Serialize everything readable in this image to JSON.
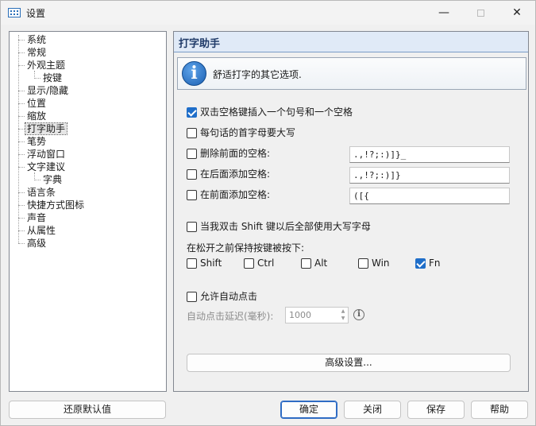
{
  "window": {
    "title": "设置"
  },
  "tree": {
    "items": [
      {
        "label": "系统",
        "level": 0
      },
      {
        "label": "常规",
        "level": 0
      },
      {
        "label": "外观主题",
        "level": 0
      },
      {
        "label": "按键",
        "level": 1
      },
      {
        "label": "显示/隐藏",
        "level": 0
      },
      {
        "label": "位置",
        "level": 0
      },
      {
        "label": "缩放",
        "level": 0
      },
      {
        "label": "打字助手",
        "level": 0,
        "selected": true
      },
      {
        "label": "笔势",
        "level": 0
      },
      {
        "label": "浮动窗口",
        "level": 0
      },
      {
        "label": "文字建议",
        "level": 0
      },
      {
        "label": "字典",
        "level": 1
      },
      {
        "label": "语言条",
        "level": 0
      },
      {
        "label": "快捷方式图标",
        "level": 0
      },
      {
        "label": "声音",
        "level": 0
      },
      {
        "label": "从属性",
        "level": 0
      },
      {
        "label": "高级",
        "level": 0
      }
    ]
  },
  "panel": {
    "title": "打字助手",
    "info": "舒适打字的其它选项.",
    "options": {
      "double_space": {
        "label": "双击空格键插入一个句号和一个空格",
        "checked": true
      },
      "capitalize": {
        "label": "每句话的首字母要大写",
        "checked": false
      },
      "delete_before": {
        "label": "删除前面的空格:",
        "checked": false,
        "value": ".,!?;:)]}_"
      },
      "add_after": {
        "label": "在后面添加空格:",
        "checked": false,
        "value": ".,!?;:)]}"
      },
      "add_before": {
        "label": "在前面添加空格:",
        "checked": false,
        "value": "([{"
      },
      "shift_caps": {
        "label": "当我双击 Shift 键以后全部使用大写字母",
        "checked": false
      }
    },
    "hold_label": "在松开之前保持按键被按下:",
    "hold_keys": [
      {
        "label": "Shift",
        "checked": false
      },
      {
        "label": "Ctrl",
        "checked": false
      },
      {
        "label": "Alt",
        "checked": false
      },
      {
        "label": "Win",
        "checked": false
      },
      {
        "label": "Fn",
        "checked": true
      }
    ],
    "auto_click": {
      "label": "允许自动点击",
      "checked": false
    },
    "auto_click_delay_label": "自动点击延迟(毫秒):",
    "auto_click_delay_value": "1000",
    "advanced_button": "高级设置..."
  },
  "footer": {
    "restore": "还原默认值",
    "ok": "确定",
    "close": "关闭",
    "save": "保存",
    "help": "帮助"
  }
}
